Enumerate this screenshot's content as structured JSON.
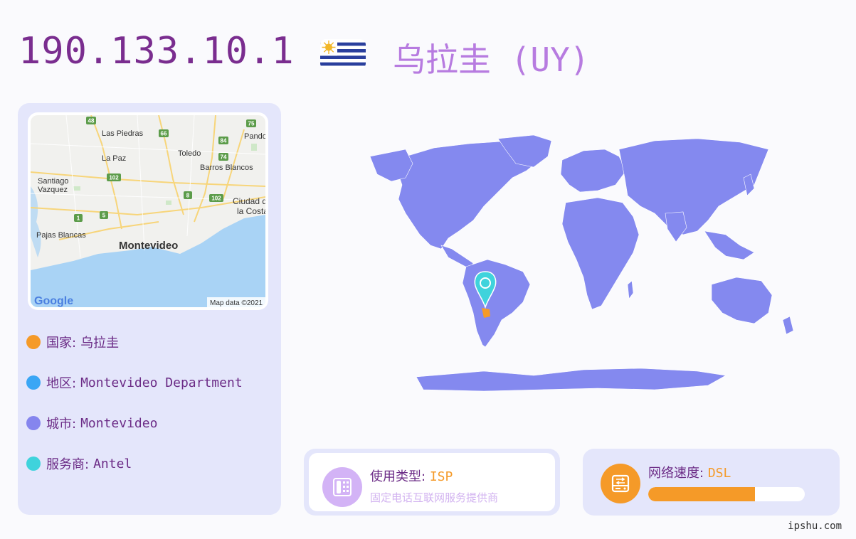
{
  "header": {
    "ip": "190.133.10.1",
    "country_title": "乌拉圭 (UY)"
  },
  "map": {
    "labels": {
      "las_piedras": "Las Piedras",
      "pando": "Pando",
      "la_paz": "La Paz",
      "toledo": "Toledo",
      "barros_blancos": "Barros Blancos",
      "santiago": "Santiago",
      "vazquez": "Vazquez",
      "ciudad": "Ciudad d",
      "la_costa": "la Costa",
      "pajas_blancas": "Pajas Blancas",
      "montevideo": "Montevideo"
    },
    "route_shields": [
      "48",
      "75",
      "66",
      "84",
      "74",
      "102",
      "102",
      "8",
      "1",
      "5"
    ],
    "logo": "Google",
    "attribution": "Map data ©2021"
  },
  "info": {
    "country": {
      "label": "国家:",
      "value": "乌拉圭",
      "color": "#f59a28"
    },
    "region": {
      "label": "地区:",
      "value": "Montevideo Department",
      "color": "#3aa6f5"
    },
    "city": {
      "label": "城市:",
      "value": "Montevideo",
      "color": "#8585ee"
    },
    "isp": {
      "label": "服务商:",
      "value": "Antel",
      "color": "#3fd3dc"
    }
  },
  "usage_card": {
    "title": "使用类型:",
    "value": "ISP",
    "subtitle": "固定电话互联网服务提供商",
    "icon": "phone-icon",
    "icon_color": "#d3b3f6"
  },
  "speed_card": {
    "title": "网络速度:",
    "value": "DSL",
    "icon": "network-drive-icon",
    "icon_color": "#f59a28",
    "progress": 0.68
  },
  "footer": {
    "site": "ipshu.com"
  },
  "colors": {
    "land": "#8489ef",
    "highlight": "#f59a28",
    "marker": "#3fd3dc",
    "accent_purple": "#7a2d8f"
  }
}
